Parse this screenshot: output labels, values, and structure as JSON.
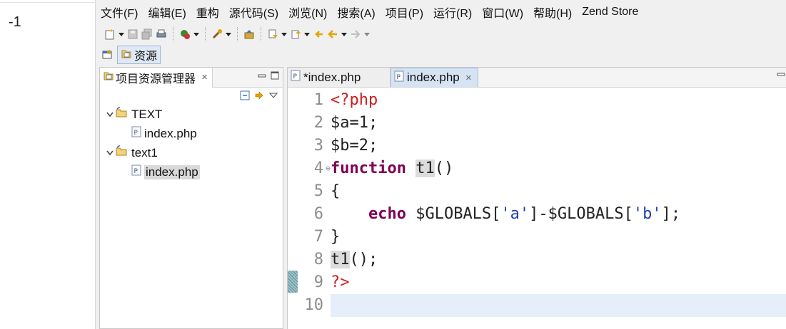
{
  "output": {
    "text": "-1"
  },
  "menu": [
    "文件(F)",
    "编辑(E)",
    "重构",
    "源代码(S)",
    "浏览(N)",
    "搜索(A)",
    "项目(P)",
    "运行(R)",
    "窗口(W)",
    "帮助(H)",
    "Zend Store"
  ],
  "perspective": {
    "label": "资源"
  },
  "explorer": {
    "title": "项目资源管理器",
    "tree": [
      {
        "label": "TEXT",
        "level": 0,
        "kind": "project"
      },
      {
        "label": "index.php",
        "level": 1,
        "kind": "php-file"
      },
      {
        "label": "text1",
        "level": 0,
        "kind": "project"
      },
      {
        "label": "index.php",
        "level": 1,
        "kind": "php-file",
        "selected": true
      }
    ]
  },
  "editor": {
    "tabs": [
      {
        "label": "*index.php",
        "active": false
      },
      {
        "label": "index.php",
        "active": true
      }
    ],
    "line_numbers": [
      "1",
      "2",
      "3",
      "4",
      "5",
      "6",
      "7",
      "8",
      "9",
      "10"
    ],
    "code": {
      "l1": "<?php",
      "l2": "$a=1;",
      "l3": "$b=2;",
      "l4_kw": "function",
      "l4_name": "t1",
      "l4_rest": "()",
      "l5": "{",
      "l6_indent": "    ",
      "l6_kw": "echo",
      "l6_a": " $GLOBALS[",
      "l6_s1": "'a'",
      "l6_b": "]-$GLOBALS[",
      "l6_s2": "'b'",
      "l6_c": "];",
      "l7": "}",
      "l8_name": "t1",
      "l8_rest": "();",
      "l9": "?>",
      "l10": ""
    }
  },
  "colors": {
    "php_tag": "#cc1f1f",
    "keyword": "#7f0055",
    "string": "#1f3db2",
    "current_line": "#e5eef9"
  }
}
